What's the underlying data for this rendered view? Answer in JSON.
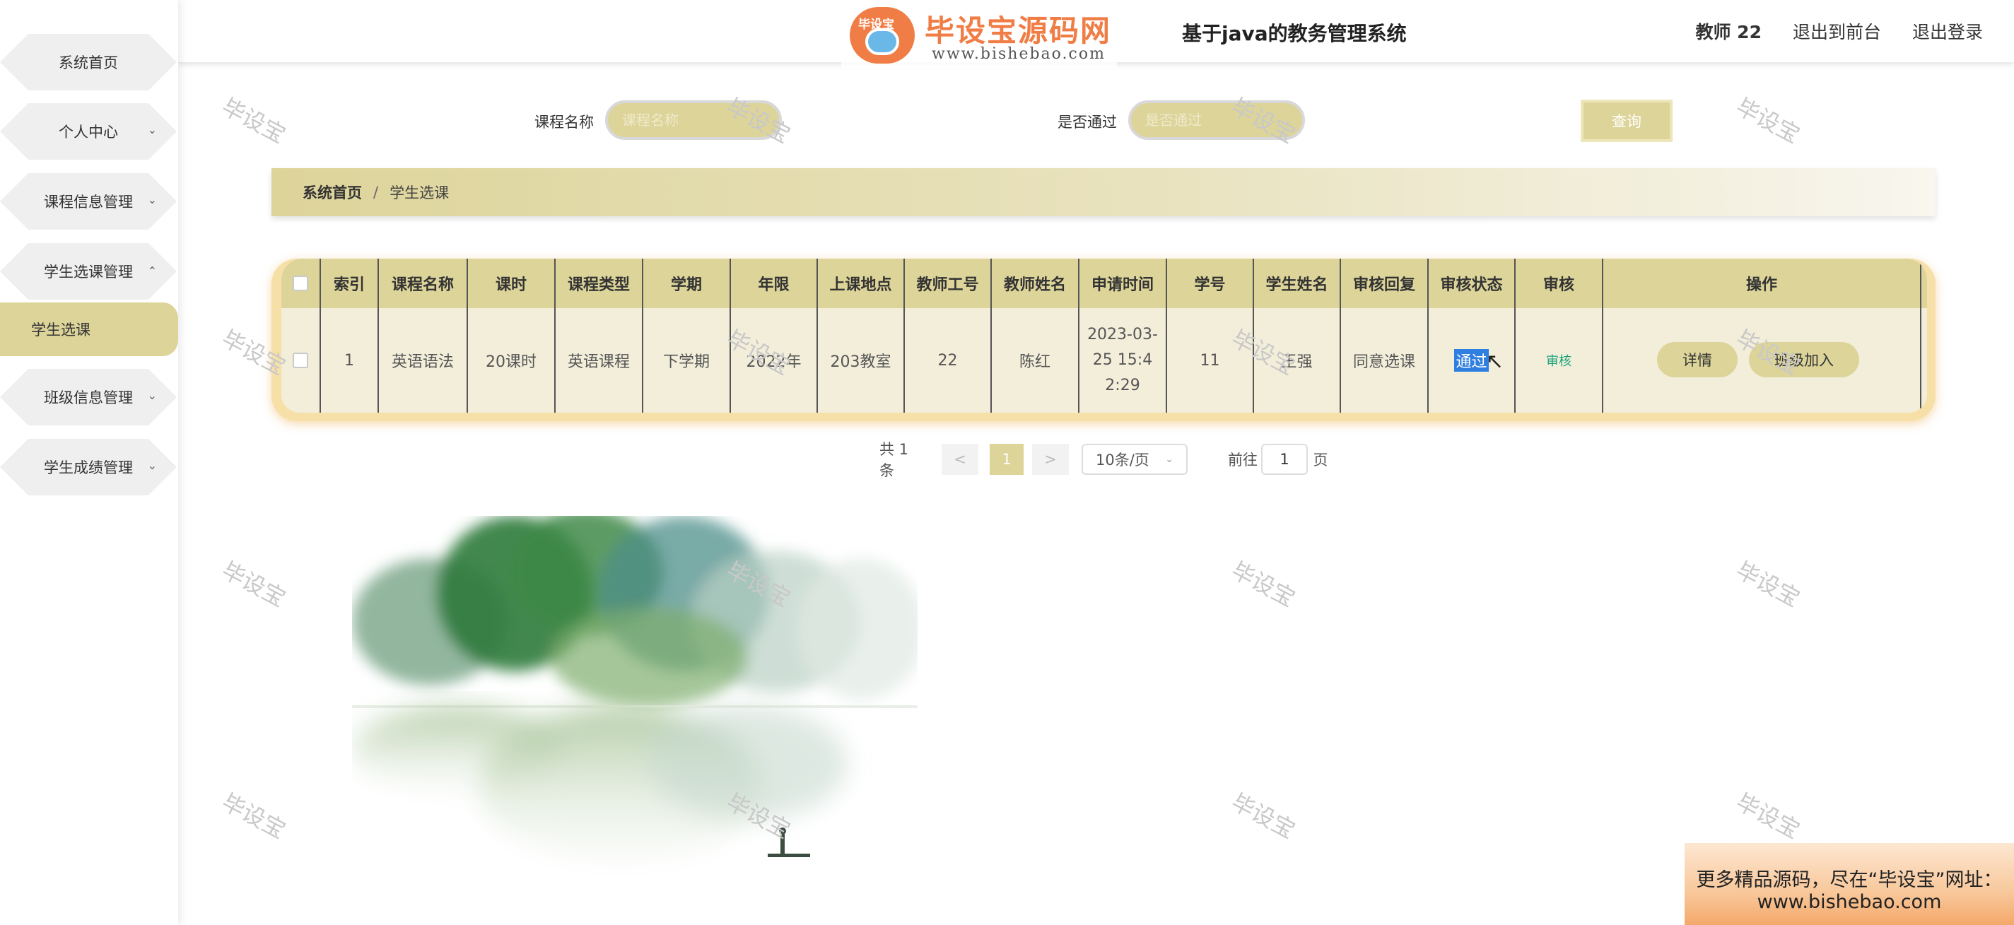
{
  "app": {
    "title": "基于java的教务管理系统",
    "logo_brand": "毕设宝源码网",
    "logo_badge": "毕设宝",
    "logo_url": "www.bishebao.com"
  },
  "header": {
    "teacher": "教师 22",
    "front_link": "退出到前台",
    "logout_link": "退出登录"
  },
  "sidebar": {
    "items": [
      {
        "label": "系统首页"
      },
      {
        "label": "个人中心"
      },
      {
        "label": "课程信息管理"
      },
      {
        "label": "学生选课管理"
      },
      {
        "label": "班级信息管理"
      },
      {
        "label": "学生成绩管理"
      }
    ],
    "active_sub": "学生选课"
  },
  "search": {
    "course_label": "课程名称",
    "course_placeholder": "课程名称",
    "passed_label": "是否通过",
    "passed_placeholder": "是否通过",
    "query_button": "查询"
  },
  "breadcrumb": {
    "home": "系统首页",
    "separator": "/",
    "current": "学生选课"
  },
  "table": {
    "headers": [
      "索引",
      "课程名称",
      "课时",
      "课程类型",
      "学期",
      "年限",
      "上课地点",
      "教师工号",
      "教师姓名",
      "申请时间",
      "学号",
      "学生姓名",
      "审核回复",
      "审核状态",
      "审核",
      "操作"
    ],
    "rows": [
      {
        "index": "1",
        "course_name": "英语语法",
        "hours": "20课时",
        "course_type": "英语课程",
        "semester": "下学期",
        "year": "2022年",
        "location": "203教室",
        "teacher_id": "22",
        "teacher_name": "陈红",
        "apply_time": "2023-03-25 15:42:29",
        "student_id": "11",
        "student_name": "王强",
        "review_reply": "同意选课",
        "review_status": "通过",
        "audit_link": "审核",
        "detail_button": "详情",
        "join_class_button": "班级加入"
      }
    ]
  },
  "pagination": {
    "total": "共 1 条",
    "prev": "<",
    "current": "1",
    "next": ">",
    "page_size": "10条/页",
    "goto_label": "前往",
    "goto_value": "1",
    "page_unit": "页"
  },
  "watermark": "毕设宝",
  "promo": {
    "line1": "更多精品源码，尽在“毕设宝”网址：",
    "line2": "www.bishebao.com"
  },
  "colors": {
    "accent": "#ddd49a",
    "table_bg": "#f2eeda",
    "table_border": "#f7e0a8",
    "audit_link": "#1aa37a"
  }
}
